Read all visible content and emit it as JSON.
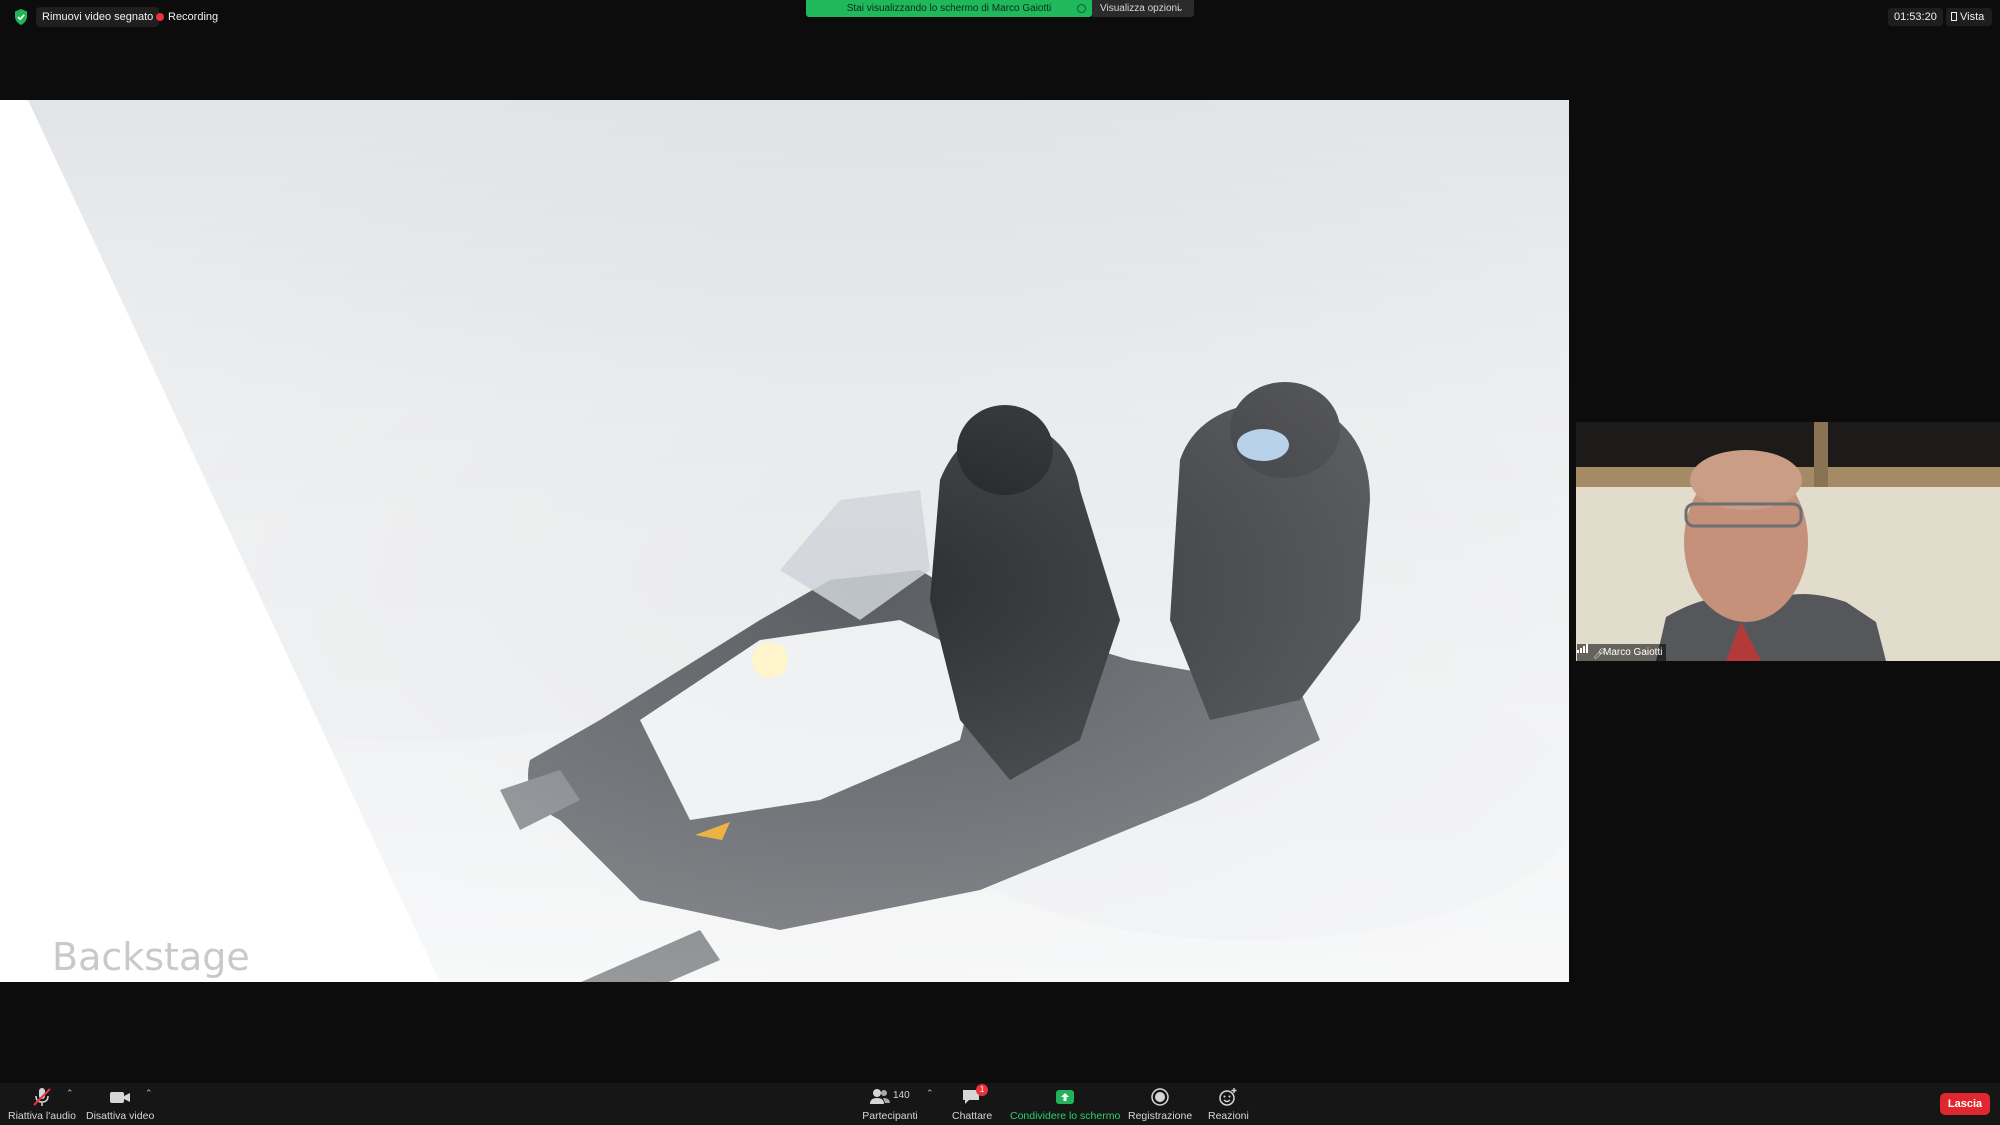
{
  "top_bar": {
    "remove_watermark_label": "Rimuovi video segnato",
    "recording_label": "Recording",
    "share_banner": "Stai visualizzando lo schermo di Marco Gaiotti",
    "view_options_label": "Visualizza opzioni",
    "clock": "01:53:20",
    "view_label": "Vista"
  },
  "shared_screen": {
    "slide_title": "Backstage"
  },
  "participant": {
    "name": "Marco Gaiotti"
  },
  "toolbar": {
    "unmute_label": "Riattiva l'audio",
    "stop_video_label": "Disattiva video",
    "participants_label": "Partecipanti",
    "participants_count": "140",
    "chat_label": "Chattare",
    "chat_badge": "1",
    "share_label": "Condividere lo schermo",
    "record_label": "Registrazione",
    "reactions_label": "Reazioni",
    "leave_label": "Lascia"
  },
  "colors": {
    "share_green": "#1fb95b",
    "recording_red": "#e8333c",
    "leave_red": "#e0262f"
  }
}
